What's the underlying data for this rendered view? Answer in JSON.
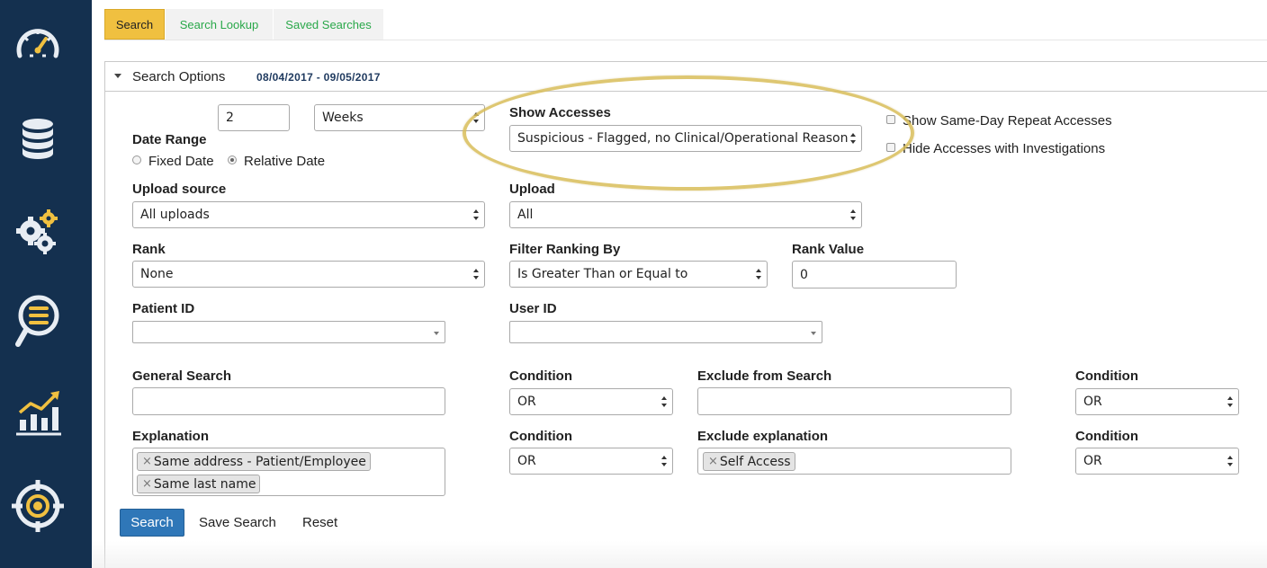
{
  "sidebar": {
    "items": [
      {
        "icon": "dashboard-gauge-icon"
      },
      {
        "icon": "database-icon"
      },
      {
        "icon": "settings-gears-icon"
      },
      {
        "icon": "search-list-icon"
      },
      {
        "icon": "analytics-chart-icon"
      },
      {
        "icon": "target-icon"
      }
    ],
    "bg_color": "#14304f",
    "accent_color": "#f0c040"
  },
  "tabs": [
    {
      "label": "Search",
      "active": true
    },
    {
      "label": "Search Lookup",
      "active": false
    },
    {
      "label": "Saved Searches",
      "active": false
    }
  ],
  "panel": {
    "title": "Search Options",
    "date_summary": "08/04/2017 - 09/05/2017"
  },
  "date_range": {
    "label": "Date Range",
    "amount_value": "2",
    "unit_value": "Weeks",
    "fixed_label": "Fixed Date",
    "relative_label": "Relative Date",
    "selected": "relative"
  },
  "show_accesses": {
    "label": "Show Accesses",
    "value": "Suspicious - Flagged, no Clinical/Operational Reason"
  },
  "options": {
    "same_day_label": "Show Same-Day Repeat Accesses",
    "same_day_checked": false,
    "hide_investigations_label": "Hide Accesses with Investigations",
    "hide_investigations_checked": false
  },
  "upload_source": {
    "label": "Upload source",
    "value": "All uploads"
  },
  "upload": {
    "label": "Upload",
    "value": "All"
  },
  "rank": {
    "label": "Rank",
    "value": "None"
  },
  "filter_ranking": {
    "label": "Filter Ranking By",
    "value": "Is Greater Than or Equal to"
  },
  "rank_value": {
    "label": "Rank Value",
    "value": "0"
  },
  "patient_id": {
    "label": "Patient ID",
    "value": ""
  },
  "user_id": {
    "label": "User ID",
    "value": ""
  },
  "general_search": {
    "label": "General Search",
    "value": ""
  },
  "condition_1": {
    "label": "Condition",
    "value": "OR"
  },
  "exclude_search": {
    "label": "Exclude from Search",
    "value": ""
  },
  "condition_2": {
    "label": "Condition",
    "value": "OR"
  },
  "explanation": {
    "label": "Explanation",
    "tags": [
      "Same address - Patient/Employee",
      "Same last name"
    ]
  },
  "condition_3": {
    "label": "Condition",
    "value": "OR"
  },
  "exclude_explanation": {
    "label": "Exclude explanation",
    "tags": [
      "Self Access"
    ]
  },
  "condition_4": {
    "label": "Condition",
    "value": "OR"
  },
  "actions": {
    "search": "Search",
    "save_search": "Save Search",
    "reset": "Reset"
  },
  "tag_remove_glyph": "×"
}
